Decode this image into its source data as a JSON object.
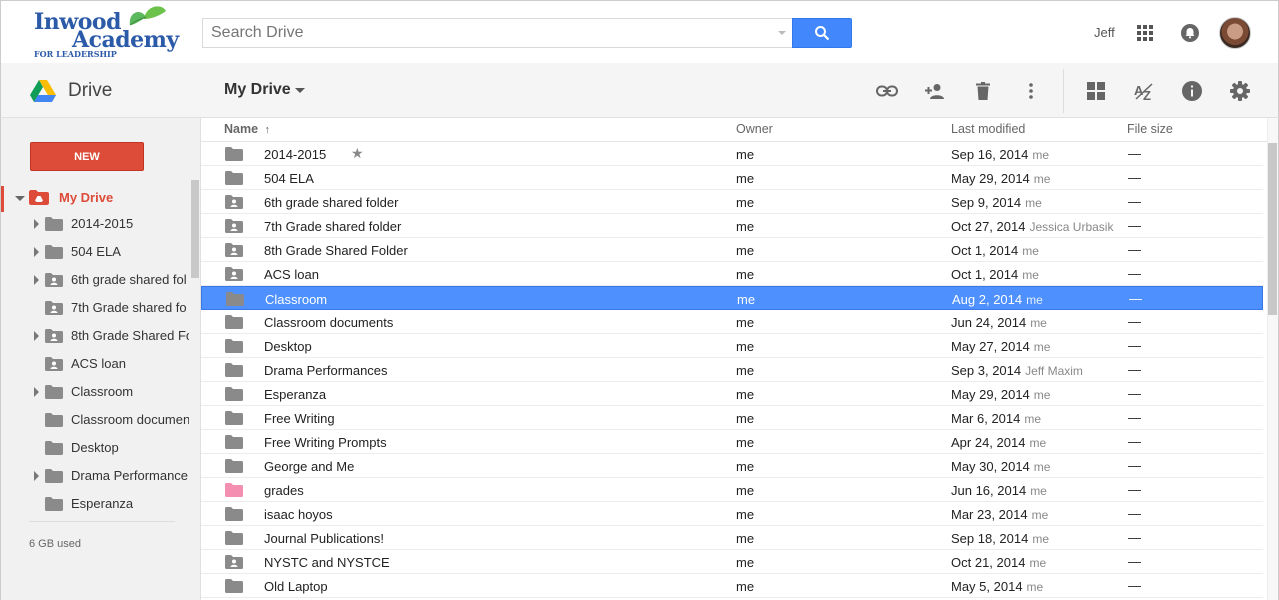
{
  "brand": {
    "line1": "Inwood",
    "line2": "Academy",
    "line3": "FOR LEADERSHIP"
  },
  "search": {
    "placeholder": "Search Drive"
  },
  "user": {
    "name": "Jeff"
  },
  "toolbar": {
    "app_label": "Drive",
    "breadcrumb": "My Drive"
  },
  "sidebar": {
    "new_label": "NEW",
    "my_drive_label": "My Drive",
    "items": [
      {
        "label": "2014-2015",
        "expandable": true,
        "shared": false
      },
      {
        "label": "504 ELA",
        "expandable": true,
        "shared": false
      },
      {
        "label": "6th grade shared fol",
        "expandable": true,
        "shared": true
      },
      {
        "label": "7th Grade shared fo",
        "expandable": false,
        "shared": true
      },
      {
        "label": "8th Grade Shared Fo",
        "expandable": true,
        "shared": true
      },
      {
        "label": "ACS loan",
        "expandable": false,
        "shared": true
      },
      {
        "label": "Classroom",
        "expandable": true,
        "shared": false
      },
      {
        "label": "Classroom documen",
        "expandable": false,
        "shared": false
      },
      {
        "label": "Desktop",
        "expandable": false,
        "shared": false
      },
      {
        "label": "Drama Performance",
        "expandable": true,
        "shared": false
      },
      {
        "label": "Esperanza",
        "expandable": false,
        "shared": false
      }
    ],
    "storage": "6 GB used"
  },
  "list": {
    "columns": {
      "name": "Name",
      "sort_arrow": "↑",
      "owner": "Owner",
      "modified": "Last modified",
      "size": "File size"
    },
    "rows": [
      {
        "name": "2014-2015",
        "owner": "me",
        "date": "Sep 16, 2014",
        "by": "me",
        "size": "—",
        "type": "folder",
        "starred": true
      },
      {
        "name": "504 ELA",
        "owner": "me",
        "date": "May 29, 2014",
        "by": "me",
        "size": "—",
        "type": "folder"
      },
      {
        "name": "6th grade shared folder",
        "owner": "me",
        "date": "Sep 9, 2014",
        "by": "me",
        "size": "—",
        "type": "shared"
      },
      {
        "name": "7th Grade shared folder",
        "owner": "me",
        "date": "Oct 27, 2014",
        "by": "Jessica Urbasik",
        "size": "—",
        "type": "shared"
      },
      {
        "name": "8th Grade Shared Folder",
        "owner": "me",
        "date": "Oct 1, 2014",
        "by": "me",
        "size": "—",
        "type": "shared"
      },
      {
        "name": "ACS loan",
        "owner": "me",
        "date": "Oct 1, 2014",
        "by": "me",
        "size": "—",
        "type": "shared"
      },
      {
        "name": "Classroom",
        "owner": "me",
        "date": "Aug 2, 2014",
        "by": "me",
        "size": "—",
        "type": "folder",
        "selected": true
      },
      {
        "name": "Classroom documents",
        "owner": "me",
        "date": "Jun 24, 2014",
        "by": "me",
        "size": "—",
        "type": "folder"
      },
      {
        "name": "Desktop",
        "owner": "me",
        "date": "May 27, 2014",
        "by": "me",
        "size": "—",
        "type": "folder"
      },
      {
        "name": "Drama Performances",
        "owner": "me",
        "date": "Sep 3, 2014",
        "by": "Jeff Maxim",
        "size": "—",
        "type": "folder"
      },
      {
        "name": "Esperanza",
        "owner": "me",
        "date": "May 29, 2014",
        "by": "me",
        "size": "—",
        "type": "folder"
      },
      {
        "name": "Free Writing",
        "owner": "me",
        "date": "Mar 6, 2014",
        "by": "me",
        "size": "—",
        "type": "folder"
      },
      {
        "name": "Free Writing Prompts",
        "owner": "me",
        "date": "Apr 24, 2014",
        "by": "me",
        "size": "—",
        "type": "folder"
      },
      {
        "name": "George and Me",
        "owner": "me",
        "date": "May 30, 2014",
        "by": "me",
        "size": "—",
        "type": "folder"
      },
      {
        "name": "grades",
        "owner": "me",
        "date": "Jun 16, 2014",
        "by": "me",
        "size": "—",
        "type": "pink"
      },
      {
        "name": "isaac hoyos",
        "owner": "me",
        "date": "Mar 23, 2014",
        "by": "me",
        "size": "—",
        "type": "folder"
      },
      {
        "name": "Journal Publications!",
        "owner": "me",
        "date": "Sep 18, 2014",
        "by": "me",
        "size": "—",
        "type": "folder"
      },
      {
        "name": "NYSTC and NYSTCE",
        "owner": "me",
        "date": "Oct 21, 2014",
        "by": "me",
        "size": "—",
        "type": "shared"
      },
      {
        "name": "Old Laptop",
        "owner": "me",
        "date": "May 5, 2014",
        "by": "me",
        "size": "—",
        "type": "folder"
      }
    ]
  },
  "colors": {
    "accent_red": "#dd4b39",
    "selection_blue": "#4d90fe",
    "search_blue": "#4387fd",
    "folder_grey": "#8a8a8a",
    "folder_pink": "#f48fb1"
  }
}
